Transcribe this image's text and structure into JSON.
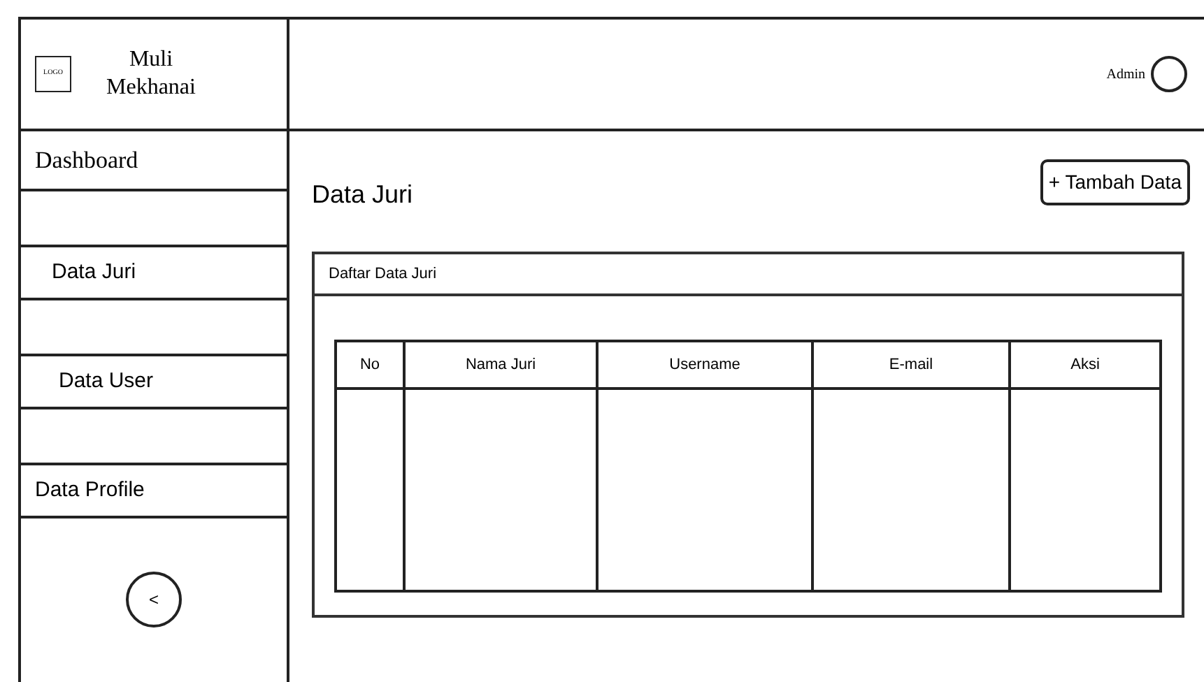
{
  "brand": {
    "logo": "LOGO",
    "name": "Muli Mekhanai"
  },
  "header": {
    "user": "Admin"
  },
  "sidebar": {
    "items": [
      {
        "label": "Dashboard",
        "kind": "title"
      },
      {
        "label": "Data Juri",
        "kind": "link"
      },
      {
        "label": "Data User",
        "kind": "link"
      },
      {
        "label": "Data Profile",
        "kind": "link"
      }
    ],
    "collapse": "<"
  },
  "page": {
    "title": "Data Juri",
    "add_button": "+ Tambah Data"
  },
  "card": {
    "title": "Daftar Data Juri",
    "table": {
      "columns": [
        "No",
        "Nama Juri",
        "Username",
        "E-mail",
        "Aksi"
      ]
    }
  }
}
